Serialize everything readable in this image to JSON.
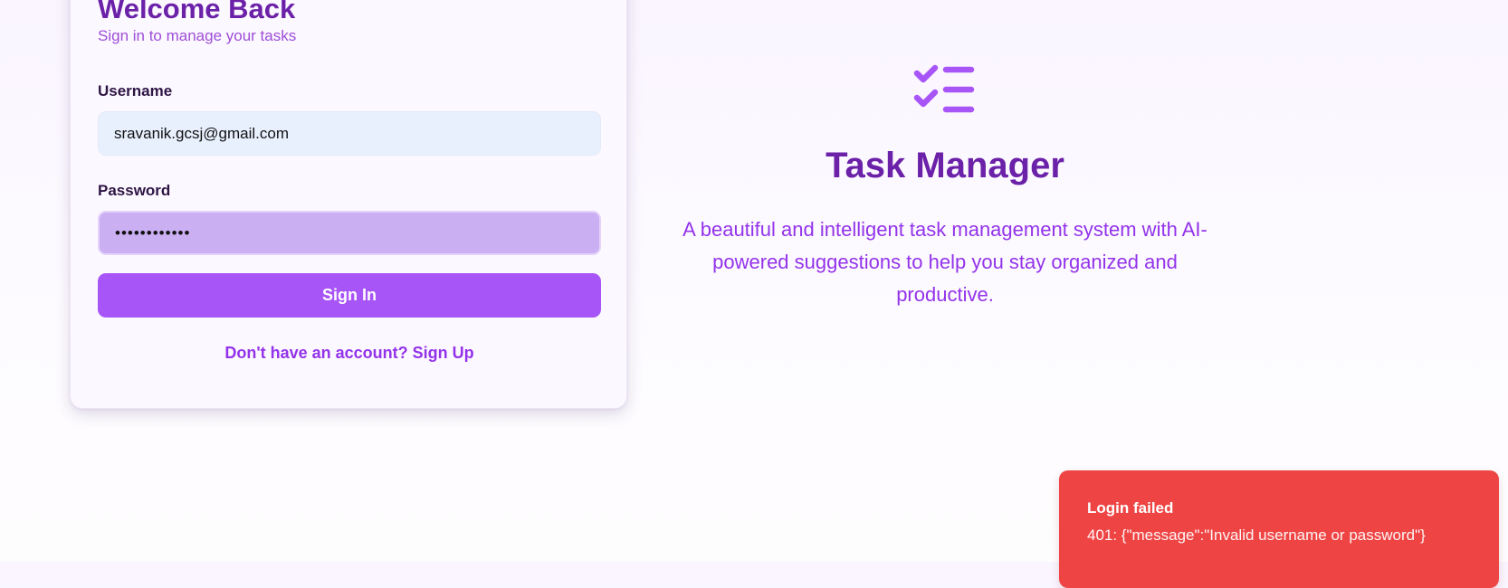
{
  "login": {
    "title": "Welcome Back",
    "subtitle": "Sign in to manage your tasks",
    "username_label": "Username",
    "username_value": "sravanik.gcsj@gmail.com",
    "password_label": "Password",
    "password_value": "••••••••••••",
    "submit_label": "Sign In",
    "signup_prompt": "Don't have an account?",
    "signup_link": "Sign Up"
  },
  "hero": {
    "icon": "checklist-icon",
    "title": "Task Manager",
    "description": "A beautiful and intelligent task management system with AI-powered suggestions to help you stay organized and productive."
  },
  "toast": {
    "title": "Login failed",
    "message": "401: {\"message\":\"Invalid username or password\"}"
  },
  "colors": {
    "accent": "#a855f7",
    "heading": "#6b21a8",
    "link": "#9333ea",
    "error": "#ef4444",
    "username_field_bg": "#e8f0fe",
    "password_field_bg": "#cbaff3"
  }
}
